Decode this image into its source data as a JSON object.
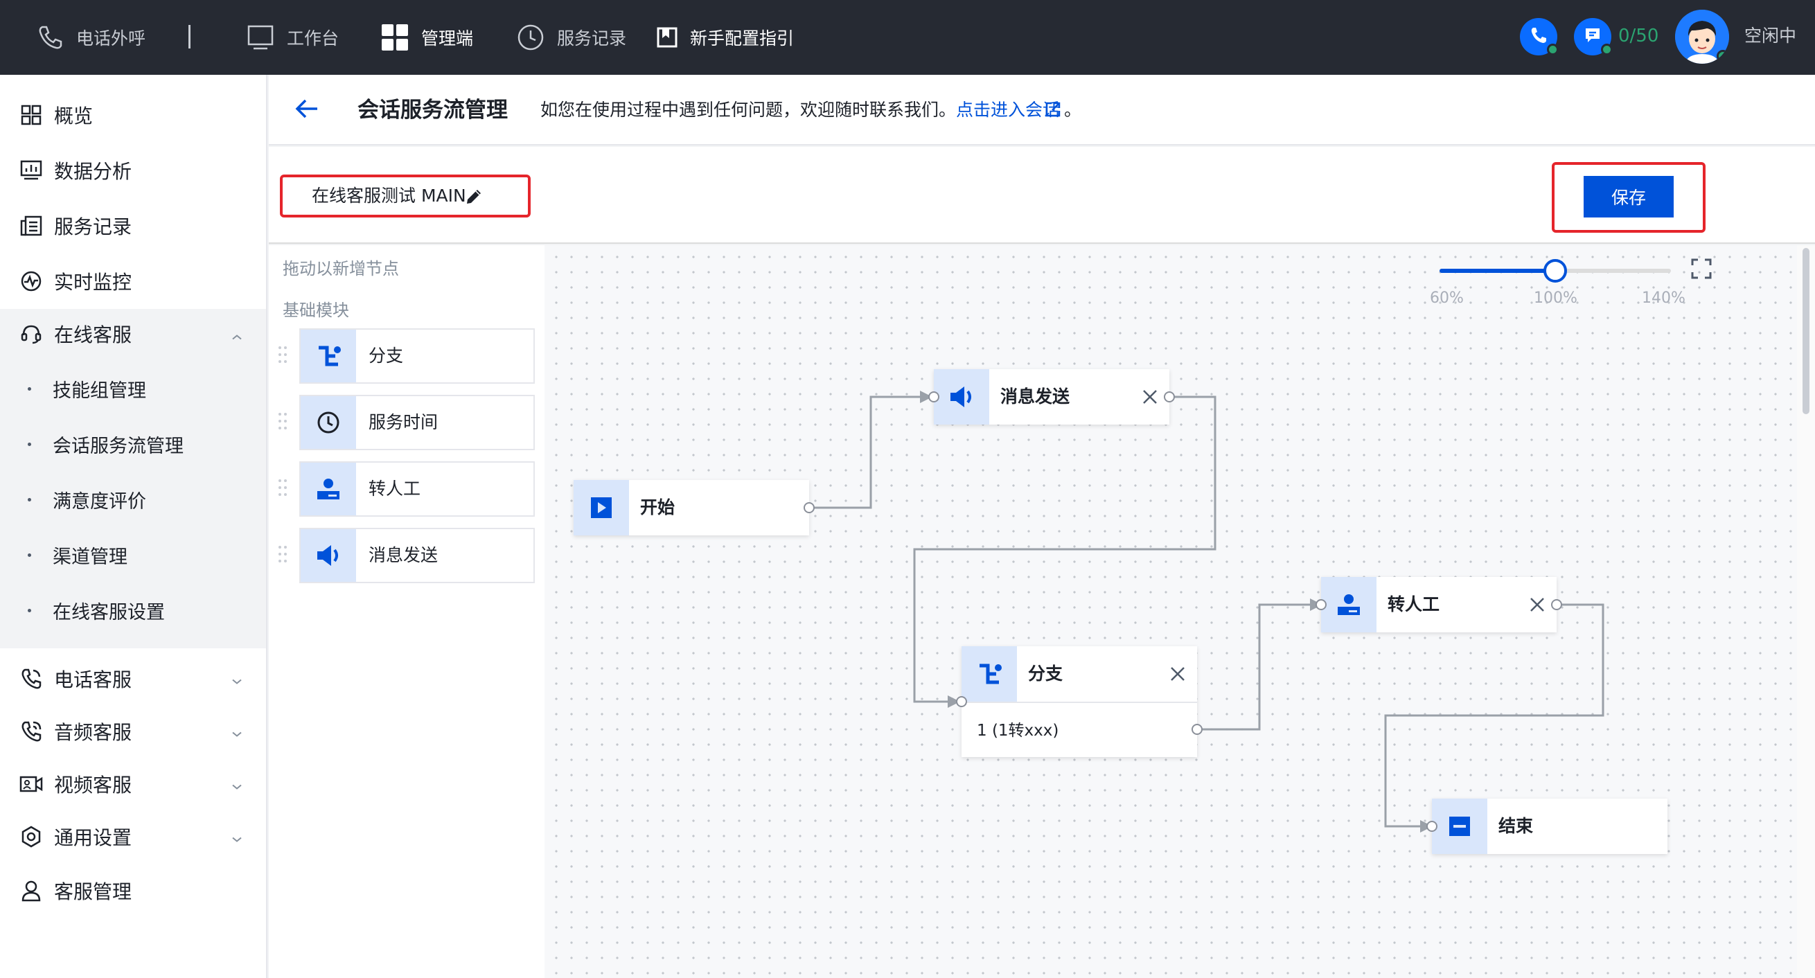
{
  "topbar": {
    "phone_out": "电话外呼",
    "workbench": "工作台",
    "admin": "管理端",
    "records": "服务记录",
    "guide": "新手配置指引",
    "count": "0/50",
    "status": "空闲中"
  },
  "sidebar": {
    "items": [
      {
        "label": "概览",
        "icon": "grid-icon"
      },
      {
        "label": "数据分析",
        "icon": "chart-icon"
      },
      {
        "label": "服务记录",
        "icon": "list-icon"
      },
      {
        "label": "实时监控",
        "icon": "pulse-icon"
      },
      {
        "label": "在线客服",
        "icon": "headset-icon"
      }
    ],
    "sub_items": [
      "技能组管理",
      "会话服务流管理",
      "满意度评价",
      "渠道管理",
      "在线客服设置"
    ],
    "more_items": [
      {
        "label": "电话客服",
        "icon": "phone-icon"
      },
      {
        "label": "音频客服",
        "icon": "phone-audio-icon"
      },
      {
        "label": "视频客服",
        "icon": "video-icon"
      },
      {
        "label": "通用设置",
        "icon": "settings-icon"
      },
      {
        "label": "客服管理",
        "icon": "user-icon"
      }
    ]
  },
  "header": {
    "title": "会话服务流管理",
    "hint": "如您在使用过程中遇到任何问题，欢迎随时联系我们。",
    "link": "点击进入会话",
    "hint_end": "。"
  },
  "toolbar": {
    "flow_name": "在线客服测试 MAIN",
    "save_label": "保存"
  },
  "palette": {
    "hint": "拖动以新增节点",
    "section": "基础模块",
    "items": [
      "分支",
      "服务时间",
      "转人工",
      "消息发送"
    ]
  },
  "zoom": {
    "labels": [
      "60%",
      "100%",
      "140%"
    ],
    "value_percent": 100
  },
  "nodes": {
    "start": "开始",
    "message": "消息发送",
    "branch": "分支",
    "branch_case": "1 (1转xxx)",
    "transfer": "转人工",
    "end": "结束"
  },
  "colors": {
    "accent": "#0052d9",
    "highlight": "#e5252b",
    "online": "#2ba471"
  }
}
